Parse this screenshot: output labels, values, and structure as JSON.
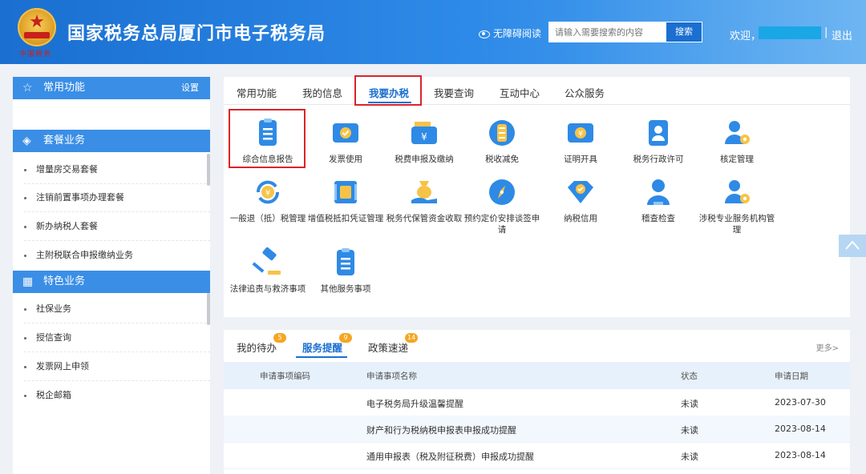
{
  "header": {
    "site_title": "国家税务总局厦门市电子税务局",
    "seal_text": "中国税务",
    "accessibility": "无障碍阅读",
    "search_placeholder": "请输入需要搜索的内容",
    "search_button": "搜索",
    "welcome": "欢迎，",
    "separator": "|",
    "logout": "退出"
  },
  "sidebar": {
    "common": {
      "title": "常用功能",
      "settings": "设置"
    },
    "package": {
      "title": "套餐业务",
      "items": [
        "增量房交易套餐",
        "注销前置事项办理套餐",
        "新办纳税人套餐",
        "主附税联合申报缴纳业务"
      ]
    },
    "special": {
      "title": "特色业务",
      "items": [
        "社保业务",
        "授信查询",
        "发票网上申领",
        "税企邮箱"
      ]
    }
  },
  "main": {
    "tabs": [
      "常用功能",
      "我的信息",
      "我要办税",
      "我要查询",
      "互动中心",
      "公众服务"
    ],
    "active_tab": "我要办税",
    "services": [
      {
        "label": "综合信息报告",
        "icon": "document-list-icon"
      },
      {
        "label": "发票使用",
        "icon": "ticket-check-icon"
      },
      {
        "label": "税费申报及缴纳",
        "icon": "wallet-yuan-icon"
      },
      {
        "label": "税收减免",
        "icon": "coin-stack-icon"
      },
      {
        "label": "证明开具",
        "icon": "yuan-ticket-icon"
      },
      {
        "label": "税务行政许可",
        "icon": "id-card-icon"
      },
      {
        "label": "核定管理",
        "icon": "user-gear-icon"
      },
      {
        "label": "一般退（抵）税管理",
        "icon": "yuan-refresh-icon"
      },
      {
        "label": "增值税抵扣凭证管理",
        "icon": "voucher-icon"
      },
      {
        "label": "税务代保管资金收取",
        "icon": "money-bag-hand-icon"
      },
      {
        "label": "预约定价安排谈签申请",
        "icon": "compass-icon"
      },
      {
        "label": "纳税信用",
        "icon": "shield-check-icon"
      },
      {
        "label": "稽查检查",
        "icon": "user-icon"
      },
      {
        "label": "涉税专业服务机构管理",
        "icon": "user-gear-icon"
      },
      {
        "label": "法律追责与救济事项",
        "icon": "gavel-icon"
      },
      {
        "label": "其他服务事项",
        "icon": "document-list-icon"
      }
    ]
  },
  "lower": {
    "tabs": [
      {
        "label": "我的待办",
        "badge": "5"
      },
      {
        "label": "服务提醒",
        "badge": "9"
      },
      {
        "label": "政策速递",
        "badge": "14"
      }
    ],
    "active_tab": "服务提醒",
    "more": "更多>",
    "columns": [
      "申请事项编码",
      "申请事项名称",
      "状态",
      "申请日期"
    ],
    "rows": [
      {
        "code": "",
        "name": "电子税务局升级温馨提醒",
        "status": "未读",
        "date": "2023-07-30"
      },
      {
        "code": "",
        "name": "财产和行为税纳税申报表申报成功提醒",
        "status": "未读",
        "date": "2023-08-14"
      },
      {
        "code": "",
        "name": "通用申报表（税及附征税费）申报成功提醒",
        "status": "未读",
        "date": "2023-08-14"
      }
    ]
  },
  "colors": {
    "header_blue": "#1a6fd0",
    "sidebar_head": "#3a8ee6",
    "active_tab": "#1a6fd0",
    "highlight_red": "#d9252a",
    "badge_orange": "#f5a623"
  }
}
